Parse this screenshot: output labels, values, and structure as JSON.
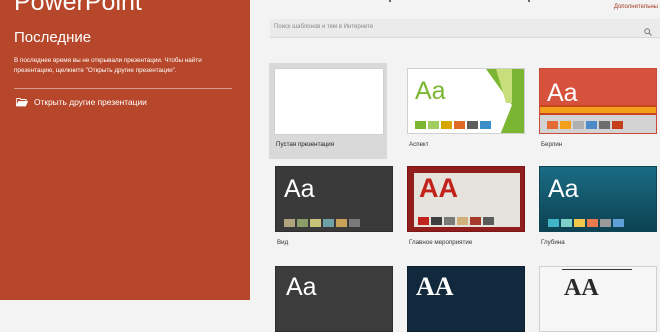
{
  "left": {
    "app_title": "PowerPoint",
    "recent_title": "Последние",
    "empty_message": "В последнее время вы не открывали презентации. Чтобы найти презентацию, щелкните \"Открыть другие презентации\".",
    "open_other_label": "Открыть другие презентации",
    "open_icon": "folder-open-icon"
  },
  "right": {
    "top_link": "Дополнительны",
    "search_placeholder": "Поиск шаблонов и тем в Интернете",
    "search_icon": "search-icon"
  },
  "templates": [
    {
      "label": "Пустая презентация",
      "thumb_text": ""
    },
    {
      "label": "Аспект",
      "thumb_text": "Aa"
    },
    {
      "label": "Берлин",
      "thumb_text": "Aa"
    },
    {
      "label": "Вид",
      "thumb_text": "Aa"
    },
    {
      "label": "Главное мероприятие",
      "thumb_text": "AA"
    },
    {
      "label": "Глубина",
      "thumb_text": "Aa"
    },
    {
      "label": "",
      "thumb_text": "Aa"
    },
    {
      "label": "",
      "thumb_text": "AA"
    },
    {
      "label": "",
      "thumb_text": "AA"
    }
  ],
  "colors": {
    "accent": "#b7472a",
    "background": "#f3f3f3"
  }
}
